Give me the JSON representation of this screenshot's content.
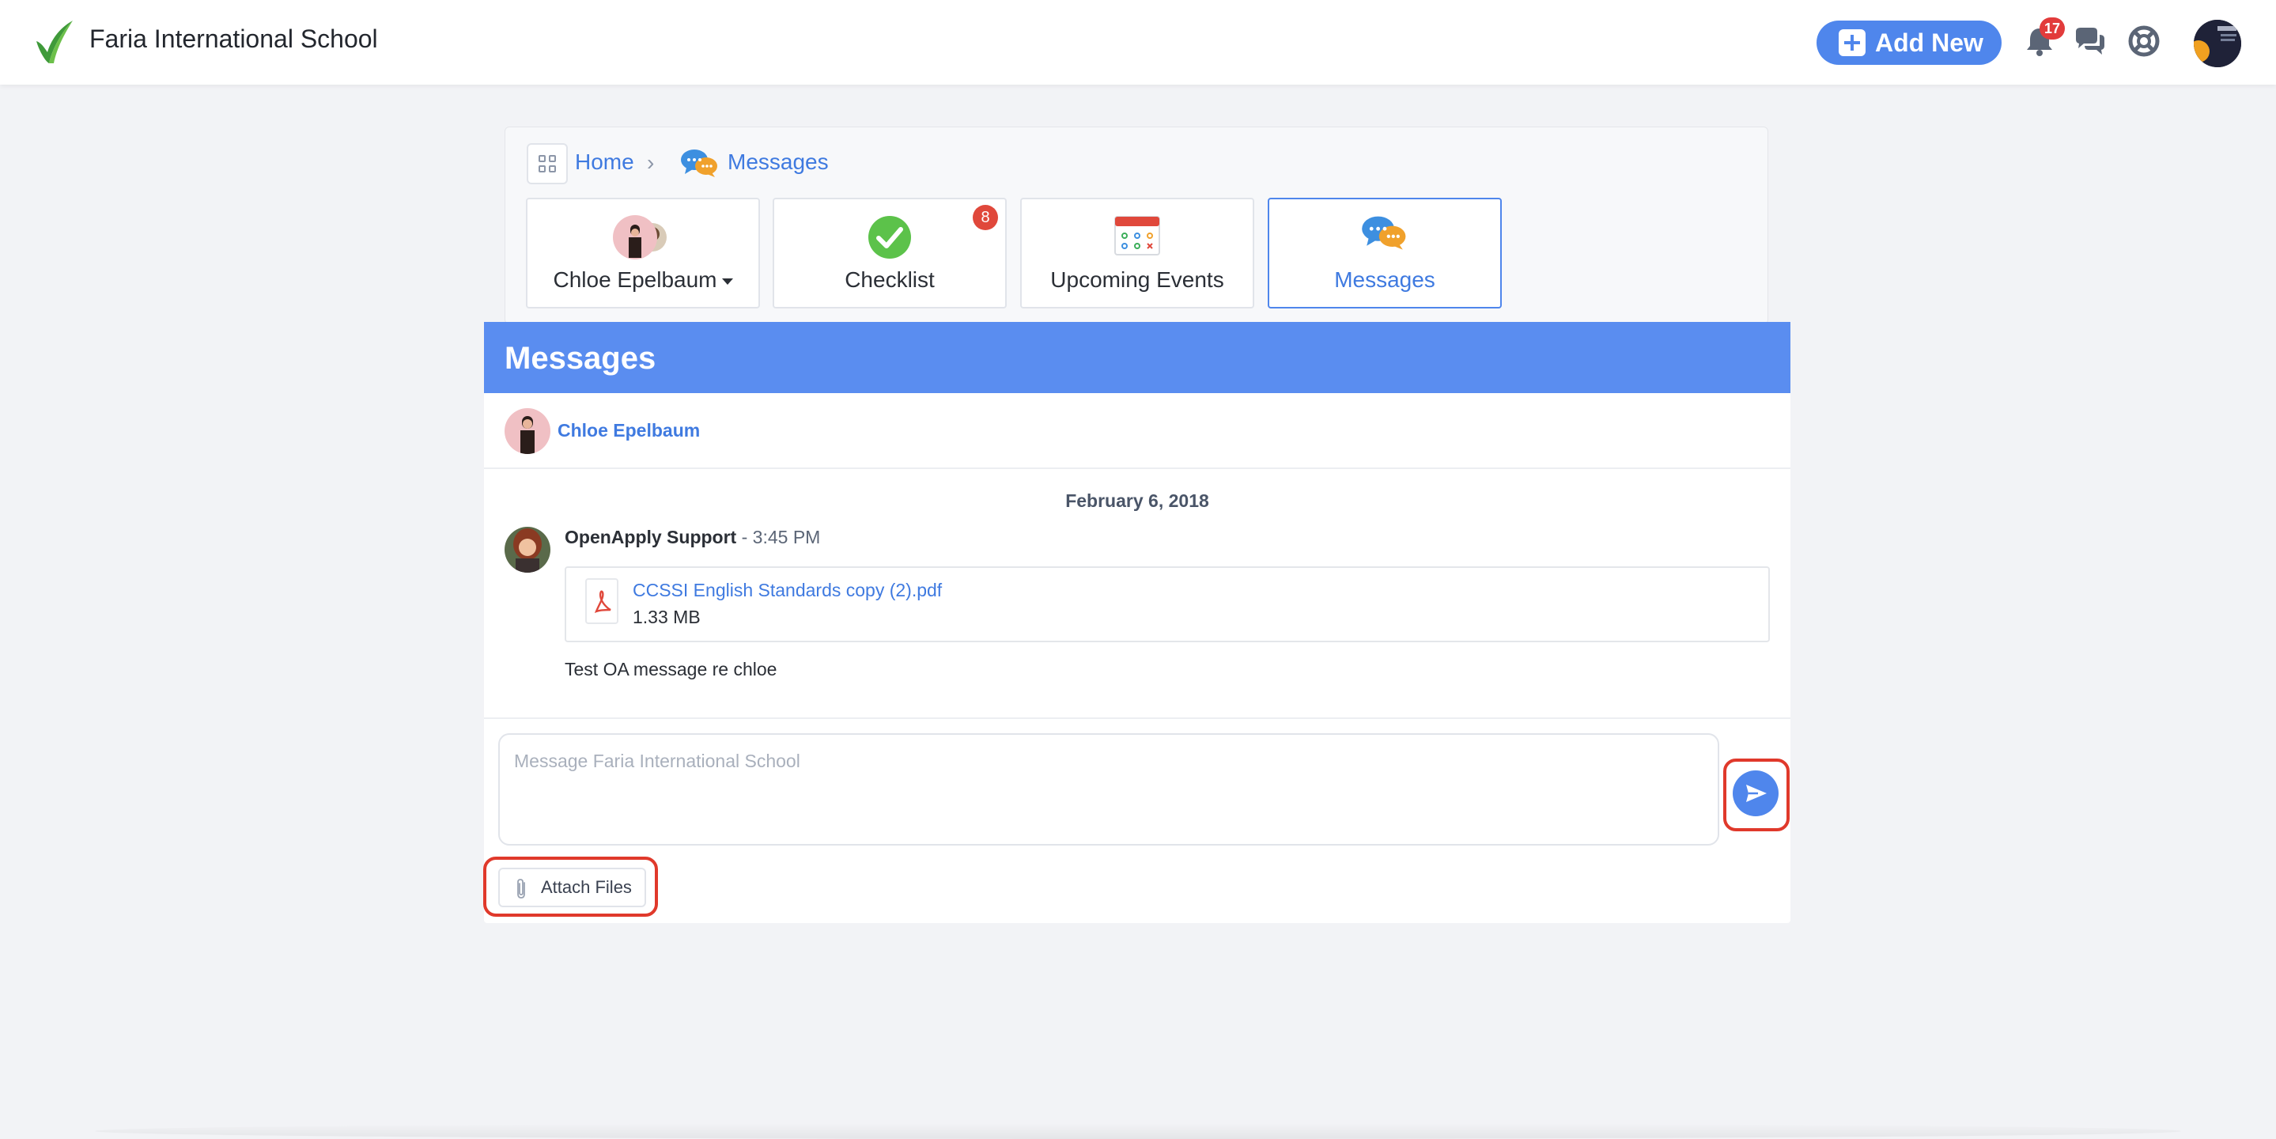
{
  "topbar": {
    "school_name": "Faria International School",
    "add_new_label": "Add New",
    "notification_count": "17",
    "icons": [
      "leaf-logo-icon",
      "plus-icon",
      "bell-icon",
      "chat-icon",
      "lifebuoy-icon"
    ]
  },
  "breadcrumb": {
    "home": "Home",
    "current": "Messages"
  },
  "tiles": [
    {
      "label": "Chloe Epelbaum",
      "icon": "student-avatar-icon",
      "has_dropdown": true
    },
    {
      "label": "Checklist",
      "icon": "check-circle-icon",
      "badge": "8"
    },
    {
      "label": "Upcoming Events",
      "icon": "calendar-icon"
    },
    {
      "label": "Messages",
      "icon": "speech-bubbles-icon",
      "active": true
    }
  ],
  "messages": {
    "title": "Messages",
    "thread_name": "Chloe Epelbaum",
    "date": "February 6, 2018",
    "sender": "OpenApply Support",
    "time": "- 3:45 PM",
    "attachment": {
      "name": "CCSSI English Standards copy (2).pdf",
      "size": "1.33 MB"
    },
    "body": "Test OA message re chloe",
    "compose_placeholder": "Message Faria International School",
    "attach_label": "Attach Files"
  },
  "colors": {
    "accent": "#4f86ec",
    "header": "#5a8df0",
    "badge": "#e23b3b",
    "highlight": "#e0392b"
  }
}
